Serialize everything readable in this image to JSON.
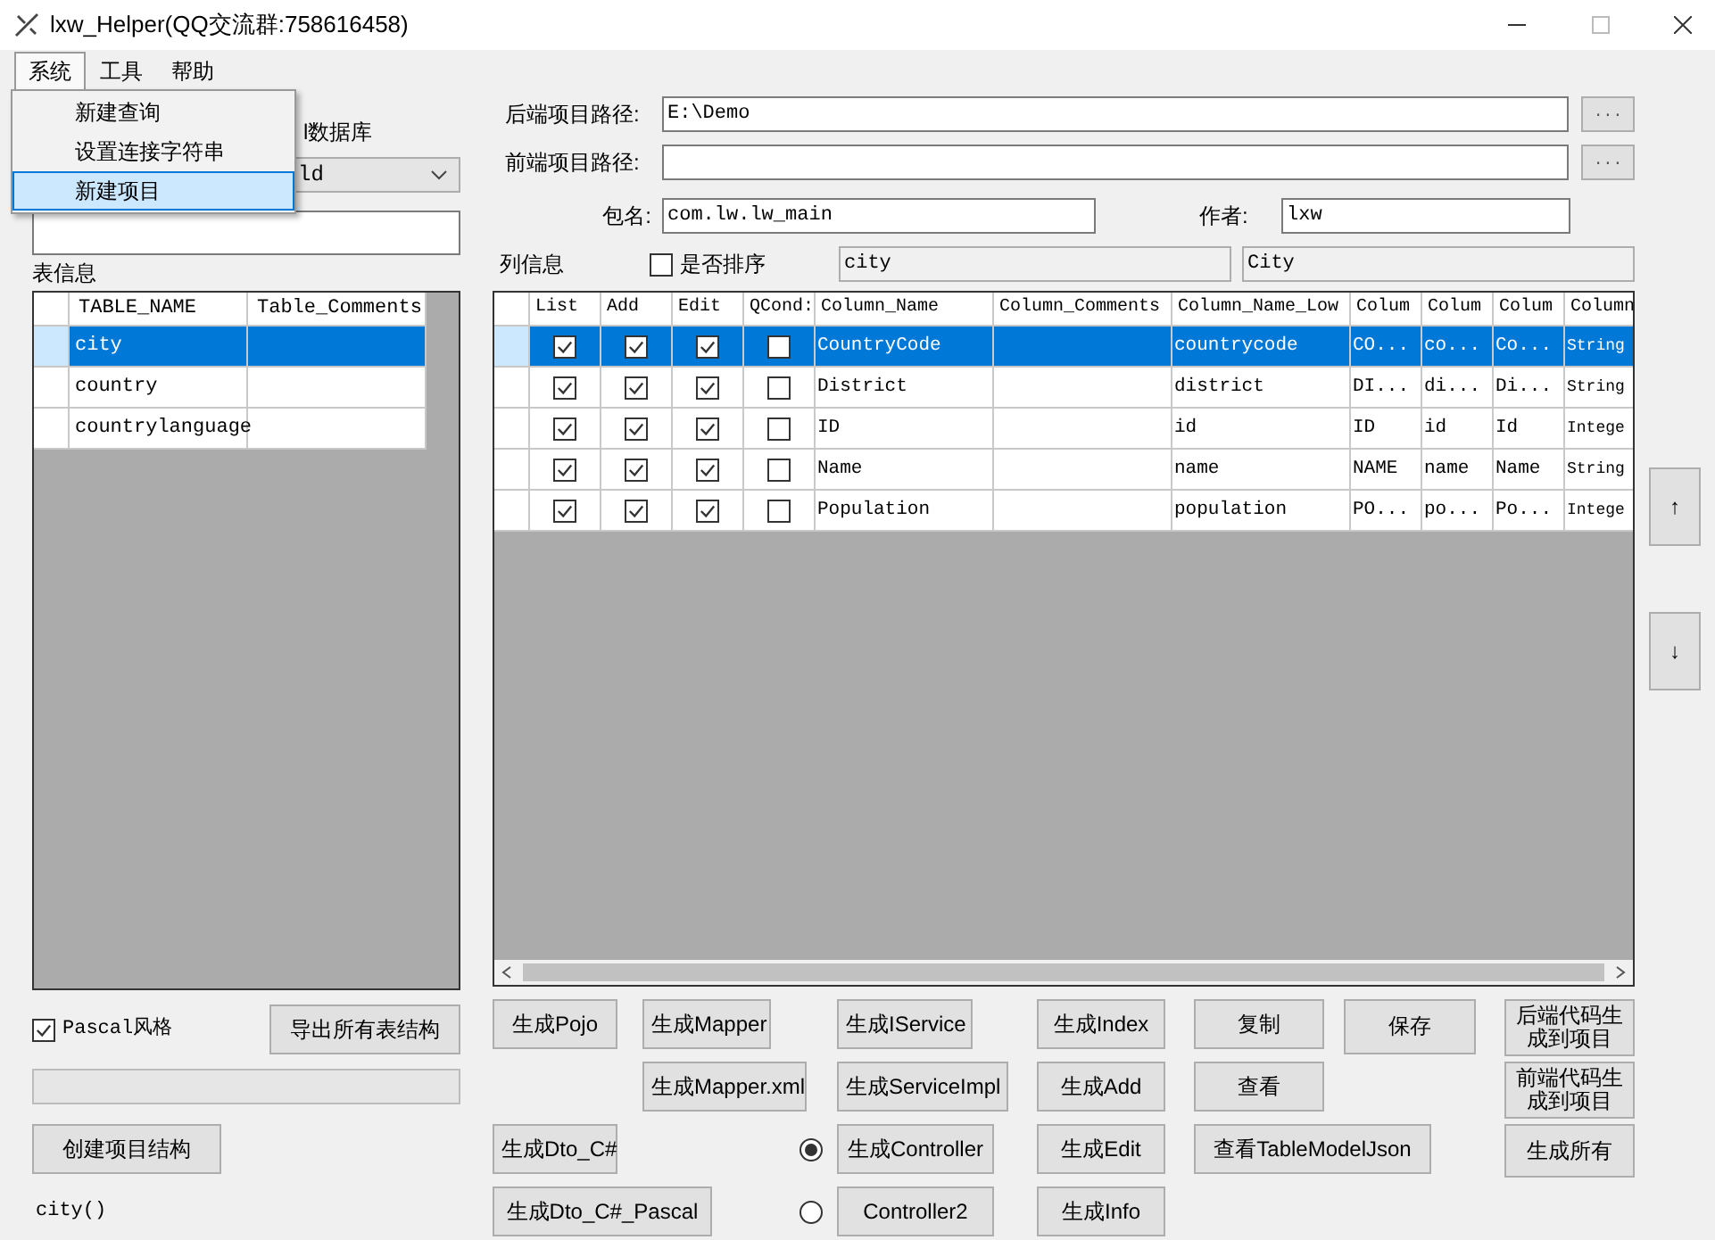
{
  "window": {
    "title": "lxw_Helper(QQ交流群:758616458)"
  },
  "menu": [
    {
      "label": "系统",
      "selected": true
    },
    {
      "label": "工具",
      "selected": false
    },
    {
      "label": "帮助",
      "selected": false
    }
  ],
  "dropdown": [
    {
      "label": "新建查询",
      "selected": false
    },
    {
      "label": "设置连接字符串",
      "selected": false
    },
    {
      "label": "新建项目",
      "selected": true
    }
  ],
  "database_label": "l数据库",
  "database_combo": {
    "value": "ld"
  },
  "tables_label": "表信息",
  "tables": {
    "columns": [
      "TABLE_NAME",
      "Table_Comments"
    ],
    "rows": [
      {
        "name": "city",
        "selected": true
      },
      {
        "name": "country",
        "selected": false
      },
      {
        "name": "countrylanguage",
        "selected": false
      }
    ]
  },
  "pascal": {
    "label": "Pascal风格",
    "checked": true
  },
  "export_button": "导出所有表结构",
  "create_button": "创建项目结构",
  "status": "city()",
  "paths": [
    {
      "label": "后端项目路径:",
      "value": "E:\\Demo",
      "browse": "..."
    },
    {
      "label": "前端项目路径:",
      "browse": "..."
    }
  ],
  "package": {
    "label": "包名:",
    "value": "com.lw.lw_main"
  },
  "author": {
    "label": "作者:",
    "value": "lxw"
  },
  "columns_label": "列信息",
  "sort": {
    "label": "是否排序",
    "checked": false
  },
  "table_field": "city",
  "class_field": "City",
  "grid": {
    "check_columns": [
      "List",
      "Add",
      "Edit",
      "QCond:"
    ],
    "columns": [
      "Column_Name",
      "Column_Comments",
      "Column_Name_Low",
      "Colum",
      "Colum",
      "Colum",
      "Column"
    ],
    "rows": [
      {
        "selected": true,
        "list": true,
        "add": true,
        "edit": true,
        "qcond": false,
        "cells": [
          "CountryCode",
          "",
          "countrycode",
          "CO...",
          "co...",
          "Co...",
          "String"
        ]
      },
      {
        "selected": false,
        "list": true,
        "add": true,
        "edit": true,
        "qcond": false,
        "cells": [
          "District",
          "",
          "district",
          "DI...",
          "di...",
          "Di...",
          "String"
        ]
      },
      {
        "selected": false,
        "list": true,
        "add": true,
        "edit": true,
        "qcond": false,
        "cells": [
          "ID",
          "",
          "id",
          "ID",
          "id",
          "Id",
          "Intege"
        ]
      },
      {
        "selected": false,
        "list": true,
        "add": true,
        "edit": true,
        "qcond": false,
        "cells": [
          "Name",
          "",
          "name",
          "NAME",
          "name",
          "Name",
          "String"
        ]
      },
      {
        "selected": false,
        "list": true,
        "add": true,
        "edit": true,
        "qcond": false,
        "cells": [
          "Population",
          "",
          "population",
          "PO...",
          "po...",
          "Po...",
          "Intege"
        ]
      }
    ]
  },
  "move_buttons": [
    "↑",
    "↓"
  ],
  "radios": [
    {
      "selected": true
    },
    {
      "selected": false
    }
  ],
  "buttons": [
    "生成Pojo",
    "生成Mapper",
    "生成IService",
    "生成Index",
    "复制",
    "保存",
    "后端代码生成到项目",
    "生成Mapper.xml",
    "生成ServiceImpl",
    "生成Add",
    "查看",
    "前端代码生成到项目",
    "生成Dto_C#",
    "生成Controller",
    "生成Edit",
    "查看TableModelJson",
    "生成所有",
    "生成Dto_C#_Pascal",
    "Controller2",
    "生成Info"
  ]
}
